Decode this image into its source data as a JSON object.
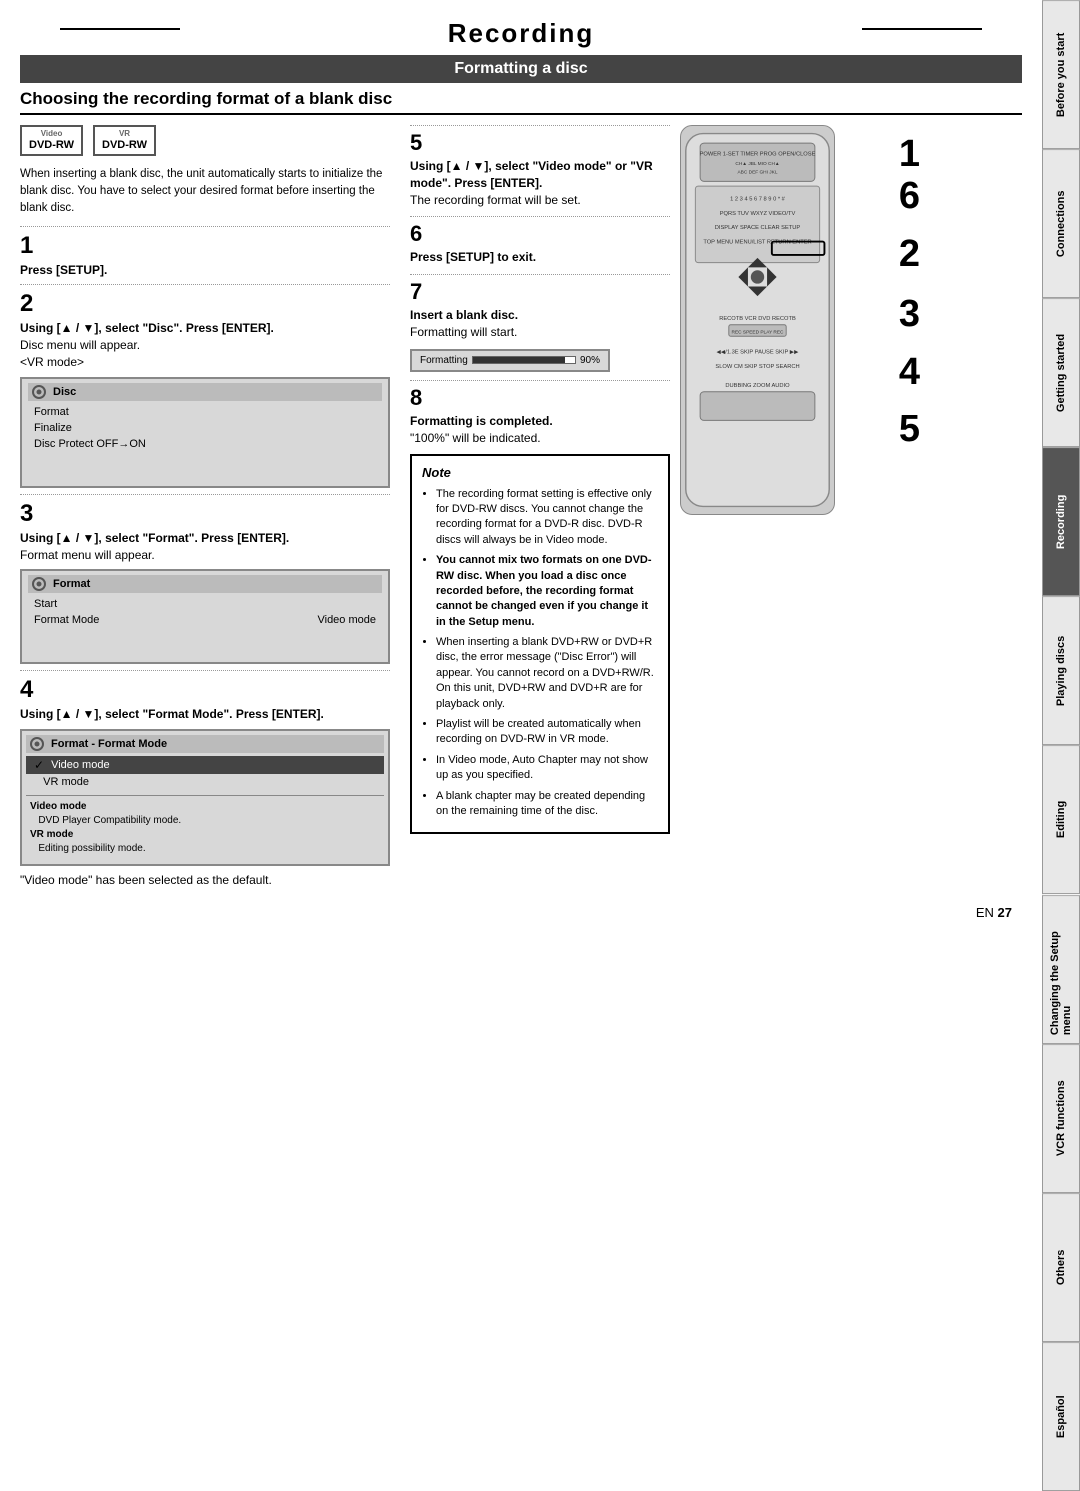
{
  "page": {
    "title": "Recording",
    "section_title": "Formatting a disc",
    "subsection_heading": "Choosing the recording format of a blank disc"
  },
  "sidebar_tabs": [
    {
      "label": "Before you start",
      "active": false
    },
    {
      "label": "Connections",
      "active": false
    },
    {
      "label": "Getting started",
      "active": false
    },
    {
      "label": "Recording",
      "active": true
    },
    {
      "label": "Playing discs",
      "active": false
    },
    {
      "label": "Editing",
      "active": false
    },
    {
      "label": "Changing the Setup menu",
      "active": false
    },
    {
      "label": "VCR functions",
      "active": false
    },
    {
      "label": "Others",
      "active": false
    },
    {
      "label": "Español",
      "active": false
    }
  ],
  "logos": [
    {
      "line1": "Video",
      "line2": "DVD-RW"
    },
    {
      "line1": "VR",
      "line2": "DVD-RW"
    }
  ],
  "intro_text": "When inserting a blank disc, the unit automatically starts to initialize the blank disc. You have to select your desired format before inserting the blank disc.",
  "steps": {
    "step1": {
      "number": "1",
      "text": "Press [SETUP]."
    },
    "step2": {
      "number": "2",
      "main": "Using [▲ / ▼], select \"Disc\". Press [ENTER].",
      "sub": "Disc menu will appear.",
      "note": "<VR mode>"
    },
    "step3": {
      "number": "3",
      "main": "Using [▲ / ▼], select \"Format\". Press [ENTER].",
      "sub": "Format menu will appear."
    },
    "step4": {
      "number": "4",
      "main": "Using [▲ / ▼], select \"Format Mode\". Press [ENTER]."
    },
    "step5": {
      "number": "5",
      "main": "Using [▲ / ▼], select \"Video mode\" or \"VR mode\". Press [ENTER].",
      "sub": "The recording format will be set."
    },
    "step6": {
      "number": "6",
      "main": "Press [SETUP] to exit."
    },
    "step7": {
      "number": "7",
      "main": "Insert a blank disc.",
      "sub": "Formatting will start."
    },
    "step8": {
      "number": "8",
      "main": "Formatting is completed.",
      "sub": "\"100%\" will be indicated."
    }
  },
  "disc_menu": {
    "title": "Disc",
    "items": [
      "Format",
      "Finalize",
      "Disc Protect OFF→ON"
    ]
  },
  "format_menu": {
    "title": "Format",
    "items": [
      {
        "label": "Start",
        "value": ""
      },
      {
        "label": "Format Mode",
        "value": "Video mode"
      }
    ]
  },
  "format_mode_menu": {
    "title": "Format - Format Mode",
    "items": [
      {
        "label": "Video mode",
        "selected": true
      },
      {
        "label": "VR mode",
        "selected": false
      }
    ],
    "descriptions": [
      {
        "label": "Video mode",
        "desc": "DVD Player Compatibility mode."
      },
      {
        "label": "VR mode",
        "desc": "Editing possibility mode."
      }
    ]
  },
  "progress_screen": {
    "label": "Formatting",
    "percent": "90%",
    "fill_width": "90"
  },
  "default_note": "\"Video mode\" has been selected as the default.",
  "note_box": {
    "title": "Note",
    "bullets": [
      "The recording format setting is effective only for DVD-RW discs. You cannot change the recording format for a DVD-R disc. DVD-R discs will always be in Video mode.",
      "You cannot mix two formats on one DVD-RW disc. When you load a disc once recorded before, the recording format cannot be changed even if you change it in the Setup menu.",
      "When inserting a blank DVD+RW or DVD+R disc, the error message (\"Disc Error\") will appear. You cannot record on a DVD+RW/R. On this unit, DVD+RW and DVD+R are for playback only.",
      "Playlist will be created automatically when recording on DVD-RW in VR mode.",
      "In Video mode, Auto Chapter may not show up as you specified.",
      "A blank chapter may be created depending on the remaining time of the disc."
    ],
    "bold_bullet_index": 1,
    "bold_text": "You cannot mix two formats on one DVD-RW disc. When you load a disc once recorded before, the recording format cannot be changed even if you change it in the Setup menu."
  },
  "page_number": {
    "prefix": "EN",
    "number": "27"
  },
  "right_step_numbers": [
    "1",
    "6",
    "2",
    "3",
    "4",
    "5"
  ]
}
